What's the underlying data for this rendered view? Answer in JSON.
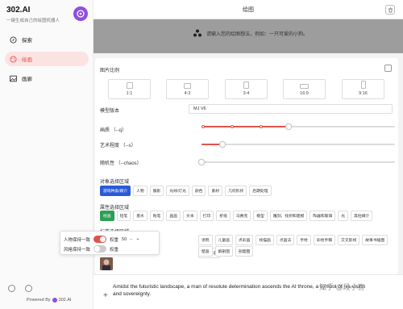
{
  "sidebar": {
    "brand_title": "302.AI",
    "brand_subtitle": "一键生成自己的绘图机器人",
    "items": [
      {
        "label": "探索",
        "icon": "explore-icon",
        "active": false
      },
      {
        "label": "绘画",
        "icon": "palette-icon",
        "active": true
      },
      {
        "label": "画廊",
        "icon": "gallery-icon",
        "active": false
      }
    ],
    "powered_prefix": "Powered By",
    "powered_brand": "302.AI"
  },
  "header": {
    "title": "绘图"
  },
  "banner": {
    "hint": "请输入您的绘图想法，例如：一只可爱的小狗。"
  },
  "panel": {
    "aspect_label": "图片比例",
    "ratios": [
      "1:1",
      "4:3",
      "3:4",
      "16:9",
      "9:16"
    ],
    "model_label": "模型版本",
    "model_value": "MJ V6",
    "quality_label": "画质 （--q）",
    "stylize_label": "艺术程度 （--s）",
    "chaos_label": "随机性 （--chaos）",
    "sliders": {
      "quality": 0.45,
      "stylize": 0.11,
      "chaos": 0.0
    },
    "object_section": "对象选择区域",
    "object_tags": [
      "游戏种类/媒介",
      "人物",
      "摄影",
      "光线/灯光",
      "颜色",
      "素材",
      "几何形状",
      "后期处理"
    ],
    "attribute_section": "属性选择区域",
    "attribute_tags": [
      "绘画",
      "铅笔",
      "墨水",
      "粉笔",
      "画画",
      "文本",
      "打印",
      "折纸",
      "马赛克",
      "模型",
      "雕刻、找到和建模",
      "陶器和玻璃",
      "光",
      "其他媒介"
    ],
    "tag_section": "标签选择区域",
    "tag_row1": [
      "涂鸦",
      "儿童画",
      "点彩画",
      "线描画",
      "点画法",
      "手绘",
      "彩绘手稿",
      "交叉影线",
      "故事书插图",
      "绘本小说"
    ],
    "tag_row2": [
      "壁画",
      "解剖图",
      "剖面图"
    ]
  },
  "popup": {
    "character_label": "人物保持一致",
    "style_label": "风格保持一致",
    "weight_label": "权重",
    "weight_value": "50",
    "minus": "−",
    "plus": "+",
    "character_on": true,
    "style_on": false
  },
  "prompt": {
    "text": "Amidst the futuristic landscape, a man of resolute determination ascends the AI throne, a symbol of his vision and sovereignty.",
    "add": "+"
  },
  "watermark": "知乎 @段小喜",
  "colors": {
    "accent": "#e0544b",
    "brand": "#8e4fe0",
    "selected_blue": "#2a5bd7",
    "selected_green": "#2e9e55"
  }
}
